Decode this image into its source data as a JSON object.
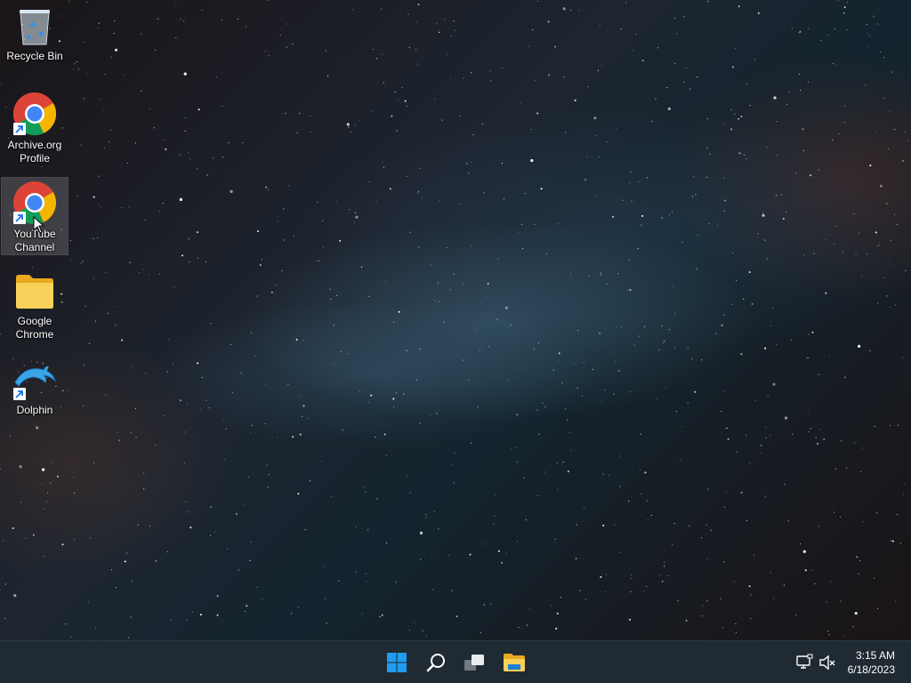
{
  "desktop": {
    "icons": [
      {
        "label": "Recycle Bin",
        "icon": "recycle-bin-icon"
      },
      {
        "label": "Archive.org Profile",
        "icon": "chrome-icon",
        "shortcut": true
      },
      {
        "label": "YouTube Channel",
        "icon": "chrome-icon",
        "shortcut": true,
        "selected": true
      },
      {
        "label": "Google Chrome",
        "icon": "folder-icon"
      },
      {
        "label": "Dolphin",
        "icon": "dolphin-icon",
        "shortcut": true
      }
    ]
  },
  "taskbar": {
    "buttons": [
      {
        "name": "start",
        "icon": "windows-start-icon"
      },
      {
        "name": "search",
        "icon": "search-icon"
      },
      {
        "name": "task-view",
        "icon": "task-view-icon"
      },
      {
        "name": "file-explorer",
        "icon": "folder-icon"
      }
    ],
    "tray": {
      "network_icon": "network-icon",
      "volume_icon": "volume-muted-icon",
      "time": "3:15 AM",
      "date": "6/18/2023"
    }
  },
  "colors": {
    "taskbar_bg": "#202a33",
    "start_blue": "#1f9cf0",
    "folder_yellow": "#f5c542"
  }
}
